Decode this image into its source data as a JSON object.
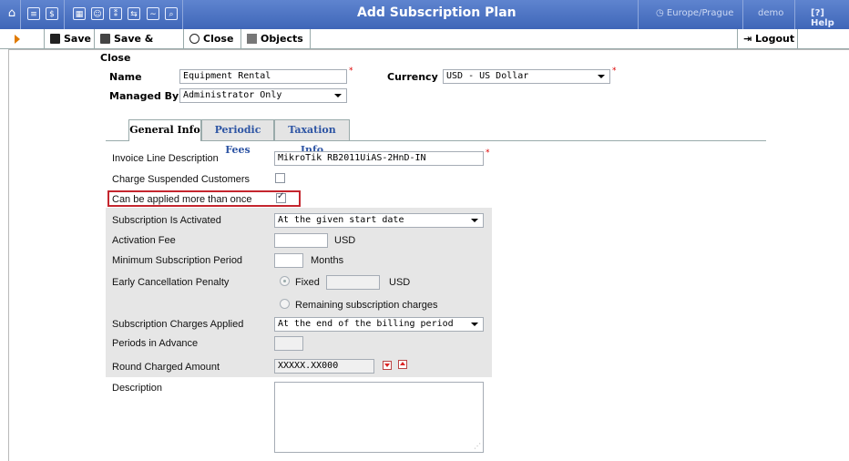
{
  "header": {
    "title": "Add Subscription Plan",
    "timezone": "Europe/Prague",
    "user": "demo",
    "help": "Help"
  },
  "toolbar": {
    "save": "Save",
    "save_close": "Save & Close",
    "close": "Close",
    "objects": "Objects",
    "logout": "Logout"
  },
  "plan": {
    "name_label": "Name",
    "name_value": "Equipment Rental",
    "currency_label": "Currency",
    "currency_value": "USD - US Dollar",
    "managed_by_label": "Managed By",
    "managed_by_value": "Administrator Only"
  },
  "tabs": [
    {
      "label": "General Info",
      "active": true
    },
    {
      "label": "Periodic Fees",
      "active": false
    },
    {
      "label": "Taxation Info",
      "active": false
    }
  ],
  "general": {
    "invoice_line_label": "Invoice Line Description",
    "invoice_line_value": "MikroTik RB2011UiAS-2HnD-IN",
    "charge_suspended_label": "Charge Suspended Customers",
    "charge_suspended_checked": false,
    "applied_more_label": "Can be applied more than once",
    "applied_more_checked": true,
    "activated_label": "Subscription Is Activated",
    "activated_value": "At the given start date",
    "activation_fee_label": "Activation Fee",
    "activation_fee_value": "",
    "activation_fee_unit": "USD",
    "min_period_label": "Minimum Subscription Period",
    "min_period_value": "",
    "min_period_unit": "Months",
    "early_cancel_label": "Early Cancellation Penalty",
    "fixed_label": "Fixed",
    "fixed_value": "",
    "fixed_unit": "USD",
    "remaining_label": "Remaining subscription charges",
    "charges_applied_label": "Subscription Charges Applied",
    "charges_applied_value": "At the end of the billing period",
    "periods_advance_label": "Periods in Advance",
    "periods_advance_value": "",
    "round_amount_label": "Round Charged Amount",
    "round_amount_value": "XXXXX.XX000",
    "description_label": "Description",
    "description_value": ""
  },
  "colors": {
    "header_blue": "#4a6fc0",
    "highlight_red": "#c4262e",
    "tab_link": "#2e55a4"
  }
}
